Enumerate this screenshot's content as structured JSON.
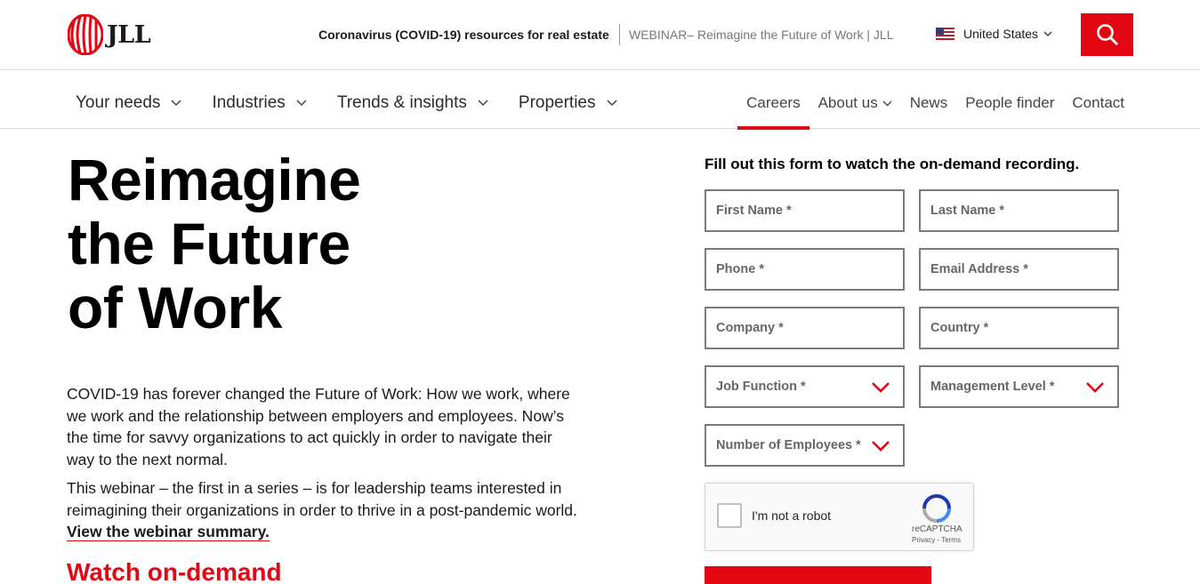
{
  "brand": {
    "name": "JLL",
    "accent": "#e30613"
  },
  "utility": {
    "covid_link": "Coronavirus (COVID-19) resources for real estate",
    "webinar_link": "WEBINAR– Reimagine the Future of Work | JLL",
    "country": "United States",
    "search_icon": "search-icon"
  },
  "nav": {
    "left": [
      "Your needs",
      "Industries",
      "Trends & insights",
      "Properties"
    ],
    "right": [
      "Careers",
      "About us",
      "News",
      "People finder",
      "Contact"
    ],
    "active": "Careers"
  },
  "hero": {
    "title_lines": [
      "Reimagine",
      "the Future",
      "of Work"
    ],
    "para1": "COVID-19 has forever changed the Future of Work: How we work, where we work and the relationship between employers and employees. Now’s the time for savvy organizations to act quickly in order to navigate their way to the next normal.",
    "para2_text": "This webinar – the first in a series – is for leadership teams interested in reimagining their organizations in order to thrive in a post-pandemic world. ",
    "para2_link": "View the webinar summary.",
    "watch": "Watch on-demand"
  },
  "form": {
    "heading": "Fill out this form to watch the on-demand recording.",
    "first_name": "First Name *",
    "last_name": "Last Name *",
    "phone": "Phone *",
    "email": "Email Address *",
    "company": "Company *",
    "country": "Country *",
    "job_function": "Job Function *",
    "management_level": "Management Level *",
    "employees": "Number of Employees *",
    "captcha_label": "I'm not a robot",
    "captcha_brand": "reCAPTCHA",
    "captcha_terms": "Privacy - Terms"
  }
}
